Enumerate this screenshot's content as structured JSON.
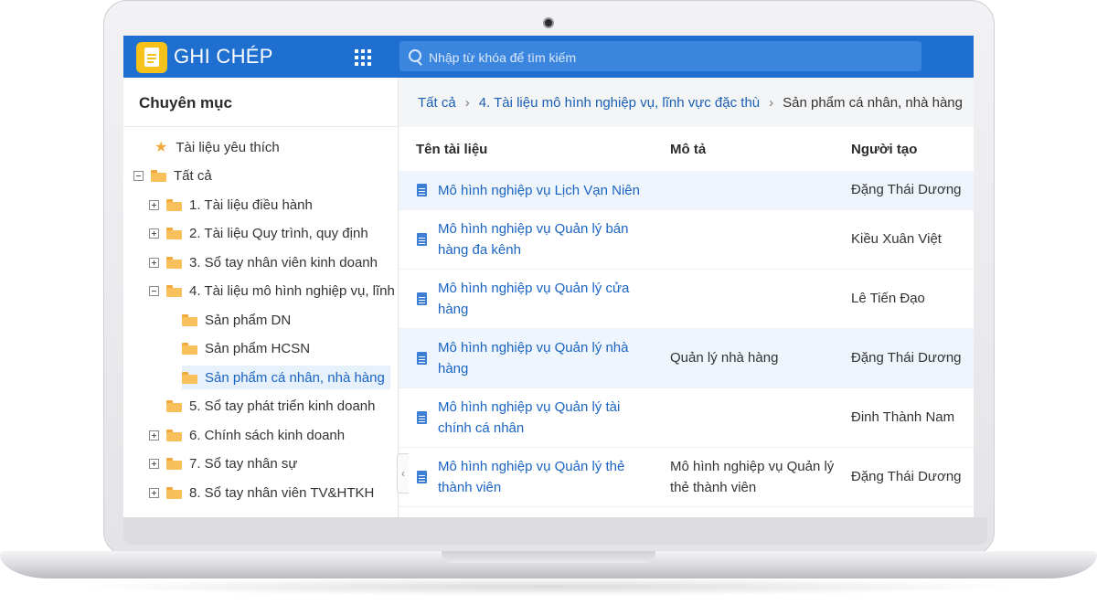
{
  "app": {
    "title": "GHI CHÉP"
  },
  "search": {
    "placeholder": "Nhập từ khóa để tìm kiếm"
  },
  "sidebar": {
    "title": "Chuyên mục",
    "favorites_label": "Tài liệu yêu thích",
    "root_label": "Tất cả",
    "items": [
      {
        "label": "1. Tài liệu điều hành",
        "toggle": "plus"
      },
      {
        "label": "2. Tài liệu Quy trình, quy định",
        "toggle": "plus"
      },
      {
        "label": "3. Sổ tay nhân viên kinh doanh",
        "toggle": "plus"
      },
      {
        "label": "4. Tài liệu mô hình nghiệp vụ, lĩnh",
        "toggle": "minus"
      },
      {
        "label": "Sản phẩm DN",
        "toggle": "none"
      },
      {
        "label": "Sản phẩm HCSN",
        "toggle": "none"
      },
      {
        "label": "Sản phẩm cá nhân, nhà hàng",
        "toggle": "none",
        "selected": true
      },
      {
        "label": "5. Sổ tay phát triển kinh doanh",
        "toggle": "none"
      },
      {
        "label": "6. Chính sách kinh doanh",
        "toggle": "plus"
      },
      {
        "label": "7. Sổ tay nhân sự",
        "toggle": "plus"
      },
      {
        "label": "8. Sổ tay nhân viên TV&HTKH",
        "toggle": "plus"
      }
    ],
    "collapse_glyph": "‹"
  },
  "breadcrumb": {
    "items": [
      "Tất cả",
      "4. Tài liệu mô hình nghiệp vụ, lĩnh vực đặc thù",
      "Sản phẩm cá nhân, nhà hàng"
    ],
    "separator": "›"
  },
  "table": {
    "headers": {
      "name": "Tên tài liệu",
      "desc": "Mô tả",
      "user": "Người tạo"
    },
    "rows": [
      {
        "name": "Mô hình nghiệp vụ Lịch Vạn Niên",
        "desc": "",
        "user": "Đặng Thái Dương",
        "highlight": true
      },
      {
        "name": "Mô hình nghiệp vụ Quản lý bán hàng đa kênh",
        "desc": "",
        "user": "Kiều Xuân Việt",
        "highlight": false
      },
      {
        "name": "Mô hình nghiệp vụ Quản lý cửa hàng",
        "desc": "",
        "user": "Lê Tiến Đạo",
        "highlight": false
      },
      {
        "name": "Mô hình nghiệp vụ Quản lý nhà hàng",
        "desc": "Quản lý nhà hàng",
        "user": "Đặng Thái Dương",
        "highlight": true
      },
      {
        "name": "Mô hình nghiệp vụ Quản lý tài chính cá nhân",
        "desc": "",
        "user": "Đinh Thành Nam",
        "highlight": false
      },
      {
        "name": "Mô hình nghiệp vụ Quản lý thẻ thành viên",
        "desc": "Mô hình nghiệp vụ Quản lý thẻ thành viên",
        "user": "Đặng Thái Dương",
        "highlight": false
      }
    ]
  },
  "colors": {
    "topbar": "#1f6fd0",
    "accent_link": "#1a64c4",
    "folder": "#f7c05a",
    "logo": "#f6c21a"
  }
}
